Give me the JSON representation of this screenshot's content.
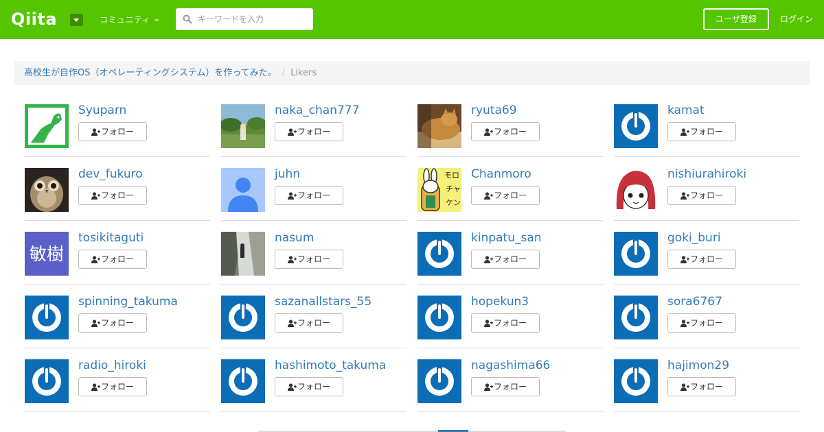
{
  "header": {
    "logo": "Qiita",
    "community_label": "コミュニティ",
    "search_placeholder": "キーワードを入力",
    "signup_label": "ユーザ登録",
    "login_label": "ログイン"
  },
  "breadcrumb": {
    "article_title": "高校生が自作OS（オペレーティングシステム）を作ってみた。",
    "separator": "/",
    "current": "Likers"
  },
  "follow_label": "フォロー",
  "users": [
    {
      "name": "Syuparn",
      "avatar": "green-bird"
    },
    {
      "name": "naka_chan777",
      "avatar": "landscape-photo"
    },
    {
      "name": "ryuta69",
      "avatar": "cat-photo"
    },
    {
      "name": "kamat",
      "avatar": "default-power"
    },
    {
      "name": "dev_fukuro",
      "avatar": "owl-photo"
    },
    {
      "name": "juhn",
      "avatar": "default-person"
    },
    {
      "name": "Chanmoro",
      "avatar": "rabbit-cartoon",
      "avatar_text": "モロ\nチャ\nケン"
    },
    {
      "name": "nishiurahiroki",
      "avatar": "anime-girl"
    },
    {
      "name": "tosikitaguti",
      "avatar": "kanji",
      "avatar_text": "敏樹"
    },
    {
      "name": "nasum",
      "avatar": "waterfall-photo"
    },
    {
      "name": "kinpatu_san",
      "avatar": "default-power"
    },
    {
      "name": "goki_buri",
      "avatar": "default-power"
    },
    {
      "name": "spinning_takuma",
      "avatar": "default-power"
    },
    {
      "name": "sazanallstars_55",
      "avatar": "default-power"
    },
    {
      "name": "hopekun3",
      "avatar": "default-power"
    },
    {
      "name": "sora6767",
      "avatar": "default-power"
    },
    {
      "name": "radio_hiroki",
      "avatar": "default-power"
    },
    {
      "name": "hashimoto_takuma",
      "avatar": "default-power"
    },
    {
      "name": "nagashima66",
      "avatar": "default-power"
    },
    {
      "name": "hajimon29",
      "avatar": "default-power"
    }
  ],
  "colors": {
    "header_bg": "#55c500",
    "link": "#337ab7",
    "default_avatar_bg": "#0a6db5"
  }
}
